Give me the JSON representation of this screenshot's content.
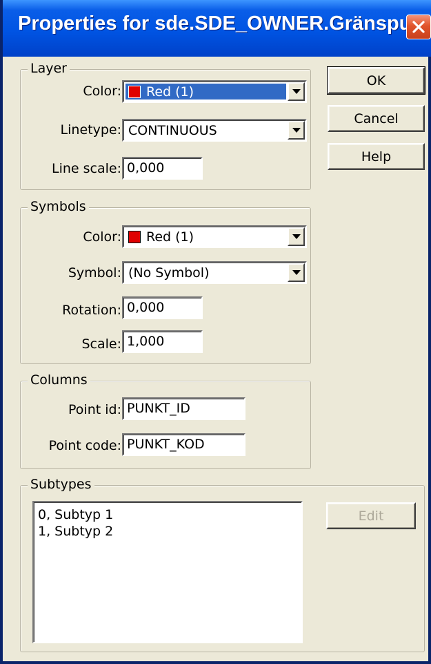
{
  "window": {
    "title": "Properties for sde.SDE_OWNER.Gränspunk..."
  },
  "layer": {
    "legend": "Layer",
    "color_label": "Color:",
    "color_value": "Red (1)",
    "linetype_label": "Linetype:",
    "linetype_value": "CONTINUOUS",
    "linescale_label": "Line scale:",
    "linescale_value": "0,000"
  },
  "symbols": {
    "legend": "Symbols",
    "color_label": "Color:",
    "color_value": "Red (1)",
    "symbol_label": "Symbol:",
    "symbol_value": "(No Symbol)",
    "rotation_label": "Rotation:",
    "rotation_value": "0,000",
    "scale_label": "Scale:",
    "scale_value": "1,000"
  },
  "columns": {
    "legend": "Columns",
    "pointid_label": "Point id:",
    "pointid_value": "PUNKT_ID",
    "pointcode_label": "Point code:",
    "pointcode_value": "PUNKT_KOD"
  },
  "subtypes": {
    "legend": "Subtypes",
    "items": [
      "0, Subtyp 1",
      "1, Subtyp 2"
    ],
    "edit_label": "Edit"
  },
  "buttons": {
    "ok": "OK",
    "cancel": "Cancel",
    "help": "Help"
  },
  "colors": {
    "title_bar": "#0054e3",
    "selection": "#316ac5",
    "swatch_red": "#e00000",
    "close_button": "#e1542b"
  },
  "icons": {
    "close": "close-icon",
    "dropdown": "chevron-down-icon",
    "swatch": "color-swatch-icon"
  }
}
